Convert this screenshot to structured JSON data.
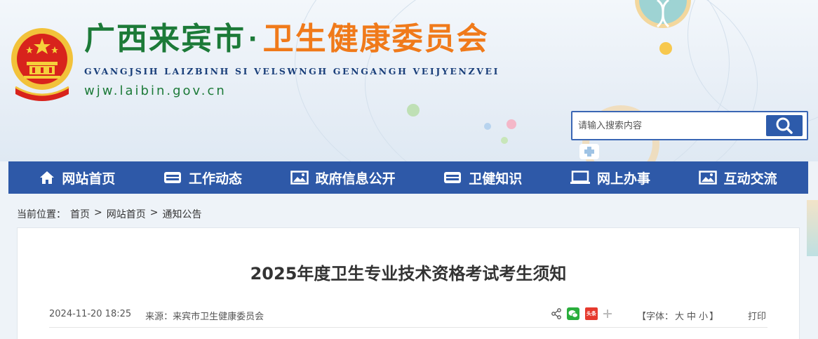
{
  "header": {
    "title_part1": "广西来宾市",
    "title_dot": "·",
    "title_part2": "卫生健康委员会",
    "pinyin": "GVANGJSIH LAIZBINH SI VELSWNGH GENGANGH VEIJYENZVEI",
    "url": "wjw.laibin.gov.cn",
    "emblem_icon": "national-emblem-icon"
  },
  "search": {
    "placeholder": "请输入搜索内容",
    "button_icon": "search-icon"
  },
  "nav": {
    "items": [
      {
        "label": "网站首页",
        "icon": "home-icon"
      },
      {
        "label": "工作动态",
        "icon": "news-icon"
      },
      {
        "label": "政府信息公开",
        "icon": "image-icon"
      },
      {
        "label": "卫健知识",
        "icon": "news-icon"
      },
      {
        "label": "网上办事",
        "icon": "monitor-icon"
      },
      {
        "label": "互动交流",
        "icon": "image-icon"
      }
    ]
  },
  "breadcrumb": {
    "prefix": "当前位置：",
    "items": [
      "首页",
      "网站首页",
      "通知公告"
    ],
    "separator": ">"
  },
  "article": {
    "title": "2025年度卫生专业技术资格考试考生须知",
    "date": "2024-11-20 18:25",
    "source": "来源：来宾市卫生健康委员会",
    "font_size_label": "【字体：",
    "font_large": "大",
    "font_medium": "中",
    "font_small": "小",
    "font_close": "】",
    "print": "打印",
    "share_icons": [
      "share-icon",
      "wechat-icon",
      "toutiao-icon",
      "plus-icon"
    ],
    "toutiao_text": "头条"
  },
  "colors": {
    "nav_bg": "#2e59a8",
    "title_green": "#1c7a38",
    "title_orange": "#f07a1a",
    "pinyin_blue": "#1a3f7a"
  }
}
